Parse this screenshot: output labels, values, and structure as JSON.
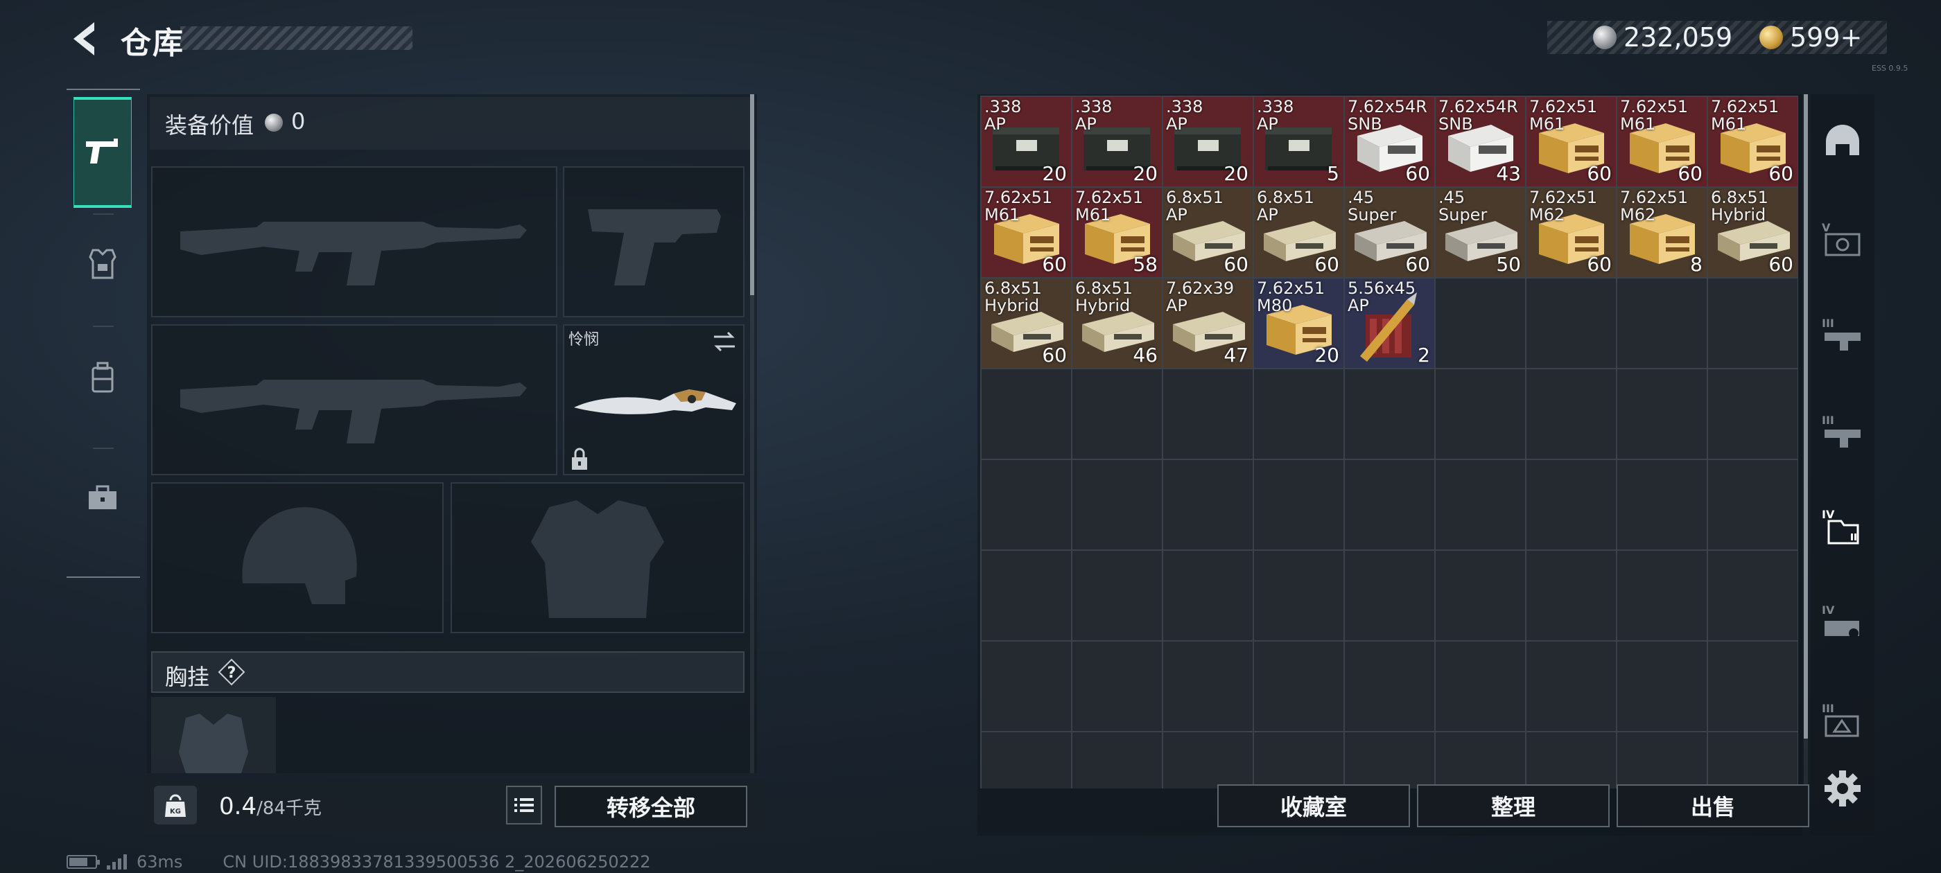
{
  "header": {
    "title": "仓库"
  },
  "currency": {
    "silver": "232,059",
    "gold": "599+"
  },
  "version_text": "ESS 0.9.5",
  "nav_tabs": [
    {
      "name": "weapons",
      "active": true
    },
    {
      "name": "equipment",
      "active": false
    },
    {
      "name": "backpack",
      "active": false
    },
    {
      "name": "kit",
      "active": false
    }
  ],
  "loadout": {
    "value_label": "装备价值",
    "value": "0",
    "knife": {
      "name": "怜悯"
    },
    "chest_rig_label": "胸挂",
    "help": "?"
  },
  "footer_left": {
    "weight_current": "0.4",
    "weight_capacity": "/84千克",
    "transfer_all": "转移全部"
  },
  "status_bar": {
    "ping": "63ms",
    "uid": "CN UID:18839833781339500536 2_202606250222"
  },
  "storage": {
    "items": [
      {
        "name": ".338\nAP",
        "count": "20",
        "rarity": "red",
        "icon": "ammo-crate"
      },
      {
        "name": ".338\nAP",
        "count": "20",
        "rarity": "red",
        "icon": "ammo-crate"
      },
      {
        "name": ".338\nAP",
        "count": "20",
        "rarity": "red",
        "icon": "ammo-crate"
      },
      {
        "name": ".338\nAP",
        "count": "5",
        "rarity": "red",
        "icon": "ammo-crate"
      },
      {
        "name": "7.62x54R\nSNB",
        "count": "60",
        "rarity": "red",
        "icon": "ammo-box-white"
      },
      {
        "name": "7.62x54R\nSNB",
        "count": "43",
        "rarity": "red",
        "icon": "ammo-box-white"
      },
      {
        "name": "7.62x51\nM61",
        "count": "60",
        "rarity": "red",
        "icon": "ammo-box-yellow"
      },
      {
        "name": "7.62x51\nM61",
        "count": "60",
        "rarity": "red",
        "icon": "ammo-box-yellow"
      },
      {
        "name": "7.62x51\nM61",
        "count": "60",
        "rarity": "red",
        "icon": "ammo-box-yellow"
      },
      {
        "name": "7.62x51\nM61",
        "count": "60",
        "rarity": "red",
        "icon": "ammo-box-yellow"
      },
      {
        "name": "7.62x51\nM61",
        "count": "58",
        "rarity": "red",
        "icon": "ammo-box-yellow"
      },
      {
        "name": "6.8x51\nAP",
        "count": "60",
        "rarity": "brown",
        "icon": "ammo-box-tan"
      },
      {
        "name": "6.8x51\nAP",
        "count": "60",
        "rarity": "brown",
        "icon": "ammo-box-tan"
      },
      {
        "name": ".45\nSuper",
        "count": "60",
        "rarity": "brown",
        "icon": "ammo-box-grey"
      },
      {
        "name": ".45\nSuper",
        "count": "50",
        "rarity": "brown",
        "icon": "ammo-box-grey"
      },
      {
        "name": "7.62x51\nM62",
        "count": "60",
        "rarity": "brown",
        "icon": "ammo-box-yellow"
      },
      {
        "name": "7.62x51\nM62",
        "count": "8",
        "rarity": "brown",
        "icon": "ammo-box-yellow"
      },
      {
        "name": "6.8x51\nHybrid",
        "count": "60",
        "rarity": "brown",
        "icon": "ammo-box-tan"
      },
      {
        "name": "6.8x51\nHybrid",
        "count": "60",
        "rarity": "brown",
        "icon": "ammo-box-tan"
      },
      {
        "name": "6.8x51\nHybrid",
        "count": "46",
        "rarity": "brown",
        "icon": "ammo-box-tan"
      },
      {
        "name": "7.62x39\nAP",
        "count": "47",
        "rarity": "brown",
        "icon": "ammo-box-tan"
      },
      {
        "name": "7.62x51\nM80",
        "count": "20",
        "rarity": "blue",
        "icon": "ammo-box-yellow"
      },
      {
        "name": "5.56x45\nAP",
        "count": "2",
        "rarity": "blue",
        "icon": "ammo-rounds"
      }
    ]
  },
  "footer_right": {
    "collection": "收藏室",
    "sort": "整理",
    "sell": "出售"
  },
  "rail_items": [
    {
      "icon": "helmet-icon"
    },
    {
      "icon": "vest-v-icon"
    },
    {
      "icon": "rig-iii-icon"
    },
    {
      "icon": "rig-iii-icon-2"
    },
    {
      "icon": "bag-iv-icon",
      "active": true
    },
    {
      "icon": "box-iv-icon"
    },
    {
      "icon": "case-iii-icon"
    }
  ],
  "colors": {
    "accent": "#35e0bd",
    "rarity_red": "#5e2328",
    "rarity_brown": "#4a3a2c",
    "rarity_blue": "#2f3350"
  }
}
